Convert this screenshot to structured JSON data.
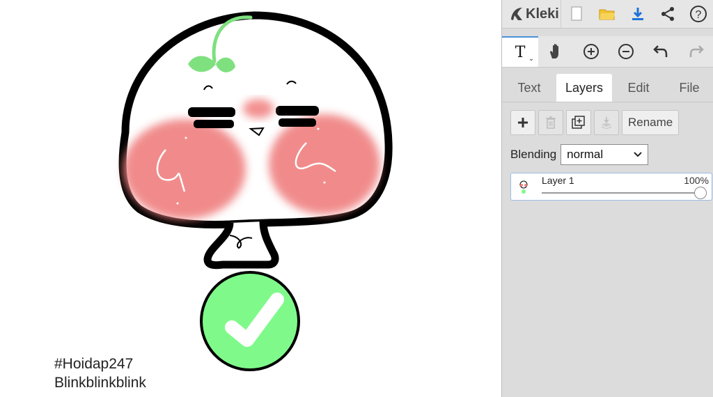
{
  "canvas": {
    "caption_line1": "#Hoidap247",
    "caption_line2": "Blinkblinkblink"
  },
  "app": {
    "name": "Kleki",
    "brand_color": "#444444",
    "accent_color": "#4a90d9"
  },
  "top_bar": {
    "buttons": [
      "new-image-icon",
      "open-folder-icon",
      "download-icon",
      "share-icon",
      "help-icon"
    ],
    "help_glyph": "?"
  },
  "tools": {
    "active": "text-tool",
    "text_tool_glyph": "T",
    "items": [
      "text-tool",
      "hand-tool",
      "zoom-in",
      "zoom-out",
      "undo",
      "redo"
    ]
  },
  "tabs": [
    {
      "label": "Text",
      "active": false
    },
    {
      "label": "Layers",
      "active": true
    },
    {
      "label": "Edit",
      "active": false
    },
    {
      "label": "File",
      "active": false
    }
  ],
  "layers_panel": {
    "buttons": [
      "add-layer-icon",
      "delete-layer-icon",
      "duplicate-layer-icon",
      "merge-down-icon"
    ],
    "rename_label": "Rename",
    "blending_label": "Blending",
    "blending_value": "normal",
    "layers": [
      {
        "name": "Layer 1",
        "opacity_label": "100%",
        "opacity": 1.0
      }
    ]
  }
}
